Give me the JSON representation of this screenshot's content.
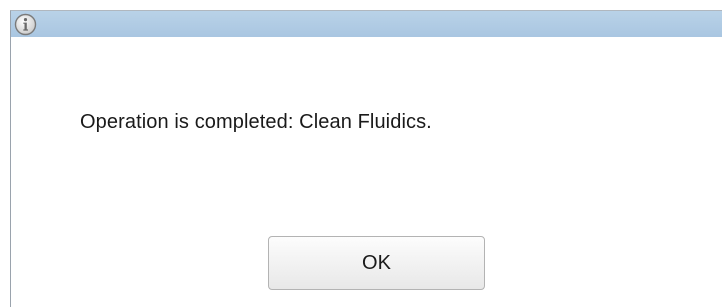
{
  "title_bar": {
    "icon": "info-icon",
    "title": ""
  },
  "message": "Operation is completed: Clean Fluidics.",
  "buttons": {
    "ok_label": "OK"
  },
  "colors": {
    "title_bar": "#aecae3",
    "background": "#ffffff",
    "button_border": "#b3b3b3",
    "text": "#1a1a1a"
  }
}
